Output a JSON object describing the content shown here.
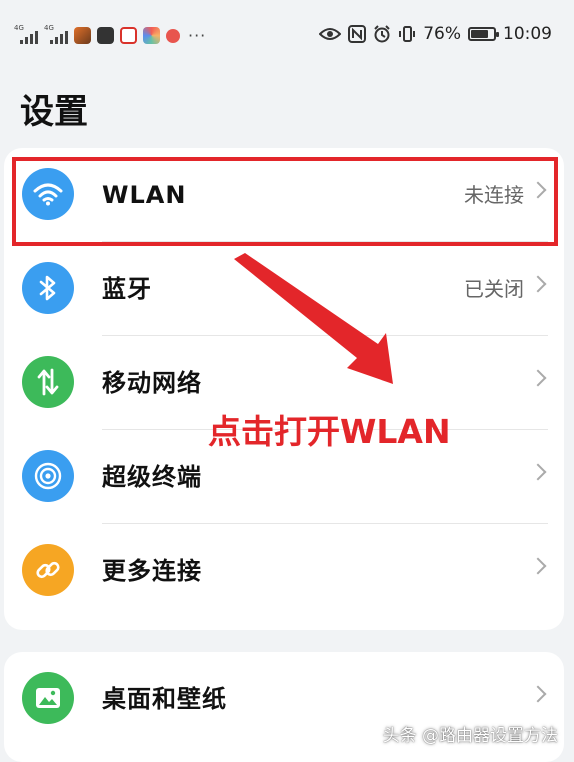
{
  "status_bar": {
    "network_tag_1": "4G",
    "network_tag_2": "4G",
    "more_indicator": "···",
    "battery_percent": "76%",
    "battery_level": 0.76,
    "time": "10:09",
    "icons": [
      "signal-icon",
      "signal-icon",
      "game-app-icon",
      "notes-app-icon",
      "red-app-icon",
      "gallery-app-icon",
      "red-dot-app-icon",
      "eye-icon",
      "nfc-icon",
      "alarm-icon",
      "vibrate-icon",
      "battery-icon"
    ]
  },
  "page": {
    "title": "设置"
  },
  "settings_group_1": [
    {
      "label": "WLAN",
      "value": "未连接",
      "icon": "wifi-icon",
      "icon_color": "#3a9ef0"
    },
    {
      "label": "蓝牙",
      "value": "已关闭",
      "icon": "bluetooth-icon",
      "icon_color": "#3a9ef0"
    },
    {
      "label": "移动网络",
      "value": "",
      "icon": "mobile-data-icon",
      "icon_color": "#3dba5a"
    },
    {
      "label": "超级终端",
      "value": "",
      "icon": "super-device-icon",
      "icon_color": "#3a9ef0"
    },
    {
      "label": "更多连接",
      "value": "",
      "icon": "link-icon",
      "icon_color": "#f6a623"
    }
  ],
  "settings_group_2": [
    {
      "label": "桌面和壁纸",
      "value": "",
      "icon": "wallpaper-icon",
      "icon_color": "#3dba5a"
    }
  ],
  "annotation": {
    "text": "点击打开WLAN",
    "color": "#e3262a"
  },
  "watermark": {
    "text": "头条 @路由器设置方法"
  }
}
